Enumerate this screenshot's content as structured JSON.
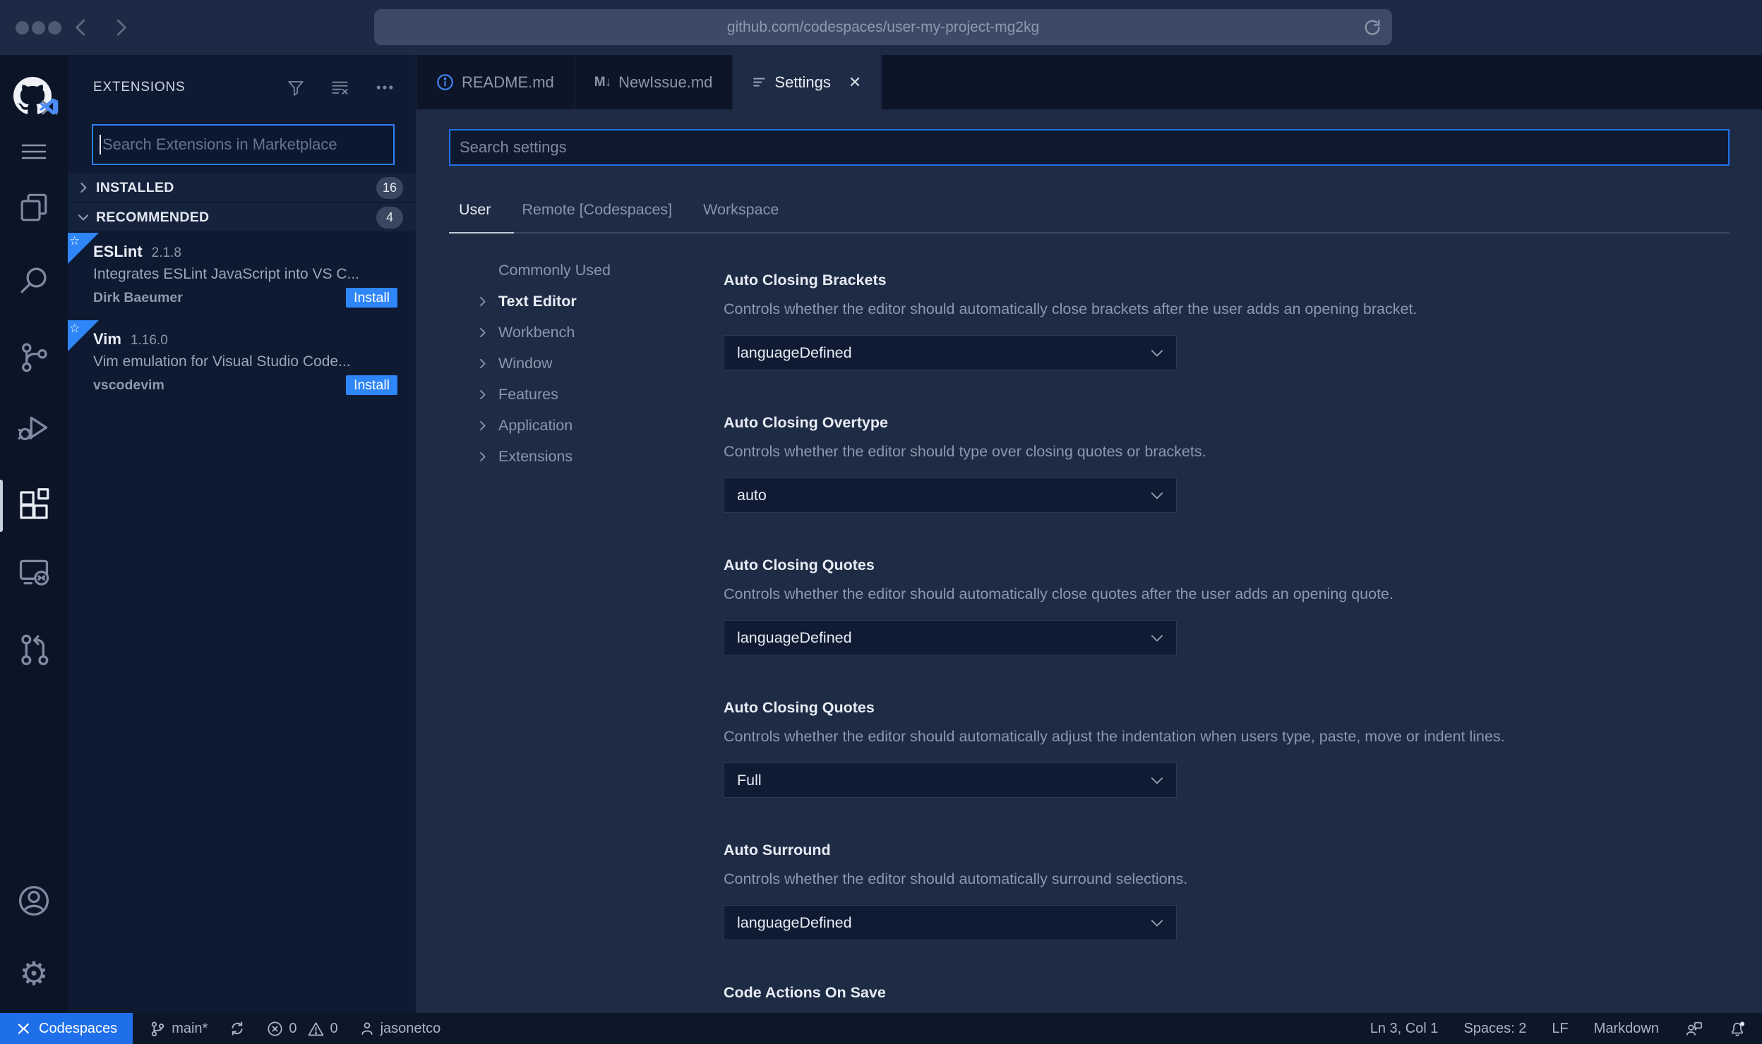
{
  "browser": {
    "url": "github.com/codespaces/user-my-project-mg2kg"
  },
  "sidebar": {
    "title": "EXTENSIONS",
    "search_placeholder": "Search Extensions in Marketplace",
    "sections": [
      {
        "label": "INSTALLED",
        "count": "16"
      },
      {
        "label": "RECOMMENDED",
        "count": "4"
      }
    ],
    "extensions": [
      {
        "name": "ESLint",
        "version": "2.1.8",
        "description": "Integrates ESLint JavaScript into VS C...",
        "author": "Dirk Baeumer",
        "action": "Install"
      },
      {
        "name": "Vim",
        "version": "1.16.0",
        "description": "Vim emulation for Visual Studio Code...",
        "author": "vscodevim",
        "action": "Install"
      }
    ]
  },
  "tabs": [
    {
      "label": "README.md"
    },
    {
      "label": "NewIssue.md"
    },
    {
      "label": "Settings"
    }
  ],
  "settings": {
    "search_placeholder": "Search settings",
    "scopes": [
      "User",
      "Remote [Codespaces]",
      "Workspace"
    ],
    "toc": [
      "Commonly Used",
      "Text Editor",
      "Workbench",
      "Window",
      "Features",
      "Application",
      "Extensions"
    ],
    "items": [
      {
        "title": "Auto Closing Brackets",
        "description": "Controls whether the editor should automatically close brackets after the user adds an opening bracket.",
        "value": "languageDefined"
      },
      {
        "title": "Auto Closing Overtype",
        "description": "Controls whether the editor should type over closing quotes or brackets.",
        "value": "auto"
      },
      {
        "title": "Auto Closing Quotes",
        "description": "Controls whether the editor should automatically close quotes after the user adds an opening quote.",
        "value": "languageDefined"
      },
      {
        "title": "Auto Closing Quotes",
        "description": "Controls whether the editor should automatically adjust the indentation when users type, paste, move or indent lines.",
        "value": "Full"
      },
      {
        "title": "Auto Surround",
        "description": "Controls whether the editor should automatically surround selections.",
        "value": "languageDefined"
      },
      {
        "title": "Code Actions On Save"
      }
    ]
  },
  "status": {
    "codespaces": "Codespaces",
    "branch": "main*",
    "errors": "0",
    "warnings": "0",
    "user": "jasonetco",
    "cursor": "Ln 3, Col 1",
    "indent": "Spaces: 2",
    "eol": "LF",
    "language": "Markdown"
  },
  "colors": {
    "accent_blue": "#2e86f8",
    "focus_border": "#2f7ef6",
    "codespaces_blue": "#1f6feb",
    "editor_bg": "#1e2b45",
    "sidebar_bg": "#0e1a31",
    "activitybar_bg": "#0b1527",
    "statusbar_bg": "#0c1728"
  }
}
